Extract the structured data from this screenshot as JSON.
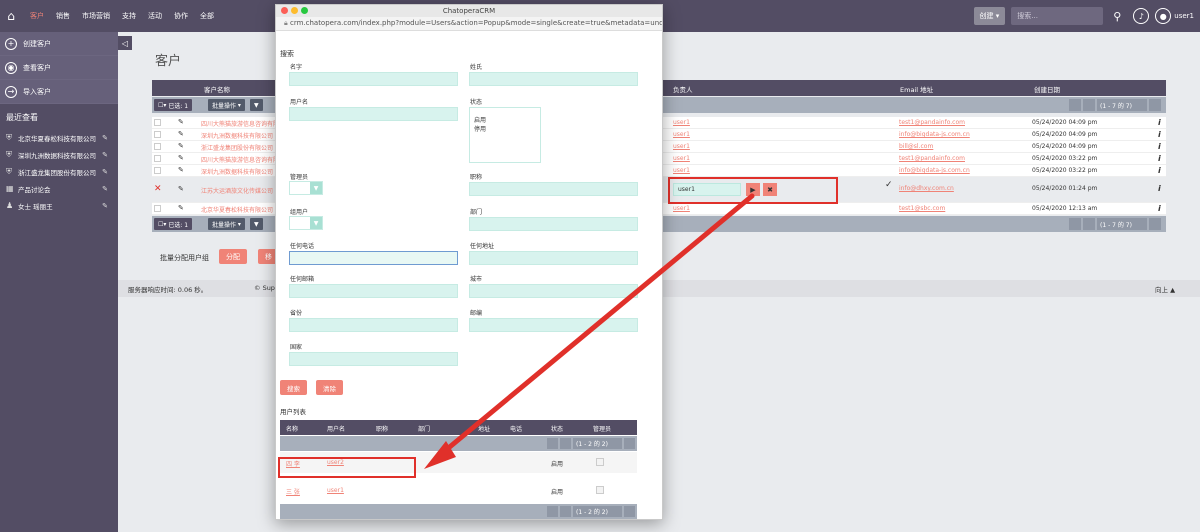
{
  "nav": {
    "items": [
      "客户",
      "销售",
      "市场营销",
      "支持",
      "活动",
      "协作",
      "全部"
    ],
    "create_label": "创建",
    "search_placeholder": "搜索...",
    "user": "user1"
  },
  "sidebar": {
    "actions": [
      "创建客户",
      "查看客户",
      "导入客户"
    ],
    "recent_title": "最近查看",
    "recent": [
      "北京华夏春松科技有限公司",
      "深圳九洲数据科技有限公司",
      "浙江盛龙集团股份有限公司",
      "产品讨论会",
      "女士 瑶丽王"
    ]
  },
  "main": {
    "title": "客户",
    "columns": {
      "name": "客户名称",
      "owner": "负责人",
      "email": "Email 地址",
      "created": "创建日期"
    },
    "selected": "已选: 1",
    "bulk": "批量操作",
    "page_info": "(1 - 7 的 7)",
    "rows": [
      {
        "name": "四川大熊猫旅游信息咨询有限公司",
        "user": "user1",
        "email": "test1@pandainfo.com",
        "date": "05/24/2020 04:09 pm"
      },
      {
        "name": "深圳九洲数据科技有限公司",
        "user": "user1",
        "email": "info@bigdata-js.com.cn",
        "date": "05/24/2020 04:09 pm"
      },
      {
        "name": "浙江盛龙集团股份有限公司",
        "user": "user1",
        "email": "bill@sl.com",
        "date": "05/24/2020 04:09 pm"
      },
      {
        "name": "四川大熊猫旅游信息咨询有限公司",
        "user": "user1",
        "email": "test1@pandainfo.com",
        "date": "05/24/2020 03:22 pm"
      },
      {
        "name": "深圳九洲数据科技有限公司",
        "user": "user1",
        "email": "info@bigdata-js.com.cn",
        "date": "05/24/2020 03:22 pm"
      },
      {
        "name": "江苏大运酒旅文化传媒公司",
        "user": "user1",
        "email": "info@dhxy.com.cn",
        "date": "05/24/2020 01:24 pm"
      },
      {
        "name": "北京华夏春松科技有限公司",
        "user": "user1",
        "email": "test1@sbc.com",
        "date": "05/24/2020 12:13 am"
      }
    ],
    "assign_label": "批量分配用户组",
    "assign_btn": "分配",
    "assign_btn2": "移",
    "footer_left": "服务器响应时间: 0.06 秒。",
    "footer_mid": "© Super",
    "footer_right": "向上 ▲"
  },
  "popup": {
    "window_title": "ChatoperaCRM",
    "url": "crm.chatopera.com/index.php?module=Users&action=Popup&mode=single&create=true&metadata=undefi...",
    "search_heading": "搜索",
    "labels": {
      "username": "名字",
      "lastname": "姓氏",
      "user_name": "用户名",
      "status": "状态",
      "admin": "管理员",
      "title": "职称",
      "group_user": "组用户",
      "department": "部门",
      "any_phone": "任何电话",
      "any_address": "任何地址",
      "any_email": "任何邮箱",
      "city": "城市",
      "state": "省份",
      "postal": "邮编",
      "country": "国家"
    },
    "status_options": [
      "启用",
      "停用"
    ],
    "search_btn": "搜索",
    "clear_btn": "清除",
    "list_heading": "用户列表",
    "list_columns": [
      "名称",
      "用户名",
      "职称",
      "部门",
      "地址",
      "电话",
      "状态",
      "管理员"
    ],
    "list_page_info": "(1 - 2 的 2)",
    "users": [
      {
        "name": "四 李",
        "username": "user2",
        "status": "启用"
      },
      {
        "name": "三 张",
        "username": "user1",
        "status": "启用"
      }
    ]
  },
  "edit_row": {
    "value": "user1"
  }
}
